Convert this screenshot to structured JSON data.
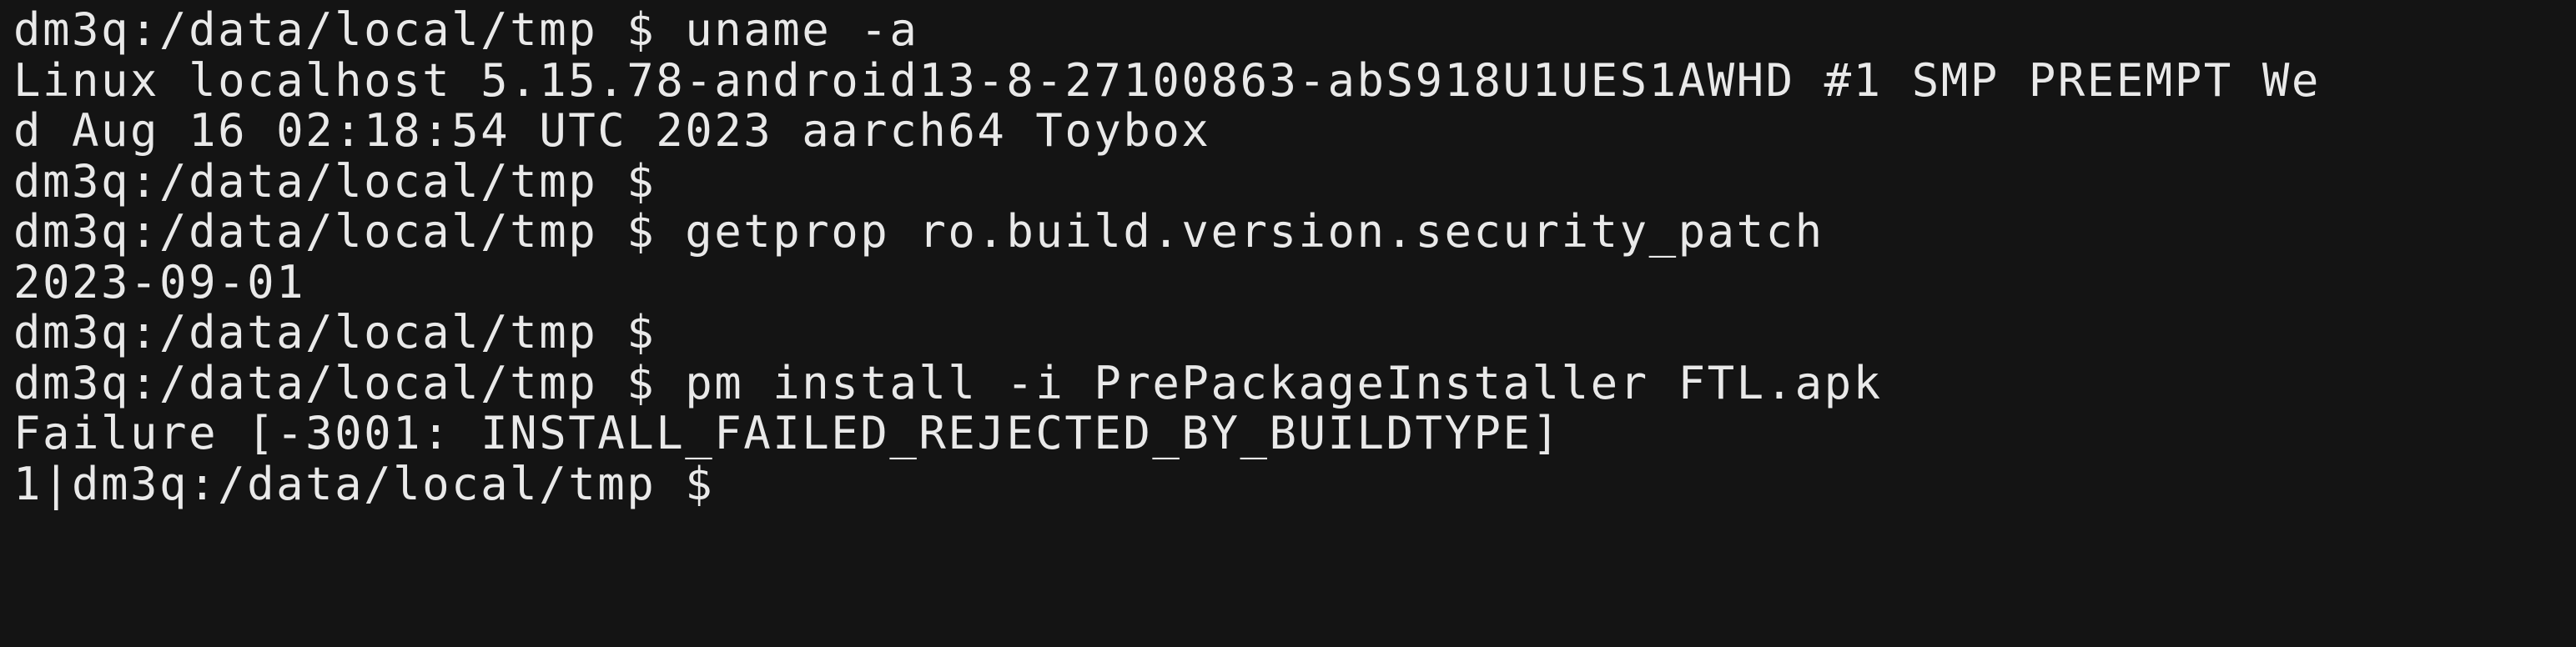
{
  "terminal": {
    "lines": [
      "dm3q:/data/local/tmp $ uname -a",
      "Linux localhost 5.15.78-android13-8-27100863-abS918U1UES1AWHD #1 SMP PREEMPT We",
      "d Aug 16 02:18:54 UTC 2023 aarch64 Toybox",
      "dm3q:/data/local/tmp $",
      "dm3q:/data/local/tmp $ getprop ro.build.version.security_patch",
      "2023-09-01",
      "dm3q:/data/local/tmp $",
      "dm3q:/data/local/tmp $ pm install -i PrePackageInstaller FTL.apk",
      "Failure [-3001: INSTALL_FAILED_REJECTED_BY_BUILDTYPE]",
      "1|dm3q:/data/local/tmp $"
    ]
  },
  "colors": {
    "background": "#141414",
    "foreground": "#e9e9e9"
  }
}
